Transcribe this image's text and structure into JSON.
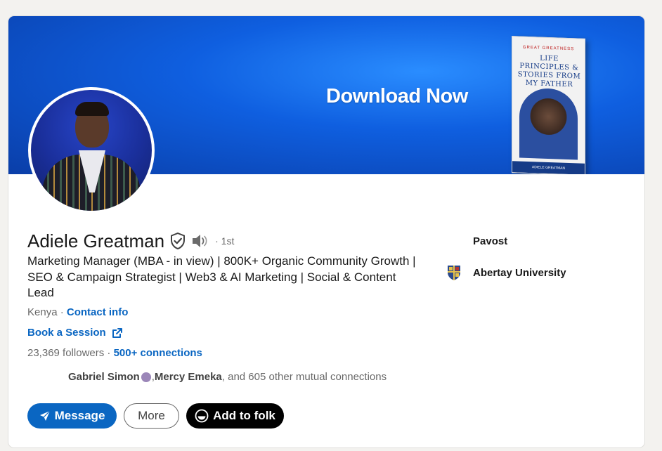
{
  "banner": {
    "title": "Download Now",
    "book_series": "GREAT GREATNESS",
    "book_title": "LIFE PRINCIPLES & STORIES FROM MY FATHER",
    "book_author": "ADIELE GREATMAN"
  },
  "profile": {
    "name": "Adiele Greatman",
    "degree": "· 1st",
    "headline": "Marketing Manager (MBA - in view) | 800K+ Organic Community Growth | SEO & Campaign Strategist | Web3 & AI Marketing | Social & Content Lead",
    "location": "Kenya",
    "location_sep": " · ",
    "contact_info": "Contact info",
    "book_session": "Book a Session",
    "followers": "23,369 followers",
    "stats_sep": " · ",
    "connections": "500+ connections",
    "mutual": {
      "name1": "Gabriel Simon",
      "sep1": ", ",
      "name2": "Mercy Emeka",
      "rest": ", and 605 other mutual connections"
    }
  },
  "actions": {
    "message": "Message",
    "more": "More",
    "add_to_folk": "Add to folk"
  },
  "sidebar": {
    "company": "Pavost",
    "education": "Abertay University"
  },
  "colors": {
    "link": "#0a66c2",
    "primary_button": "#0a66c2",
    "banner": "#0f5fe0"
  }
}
